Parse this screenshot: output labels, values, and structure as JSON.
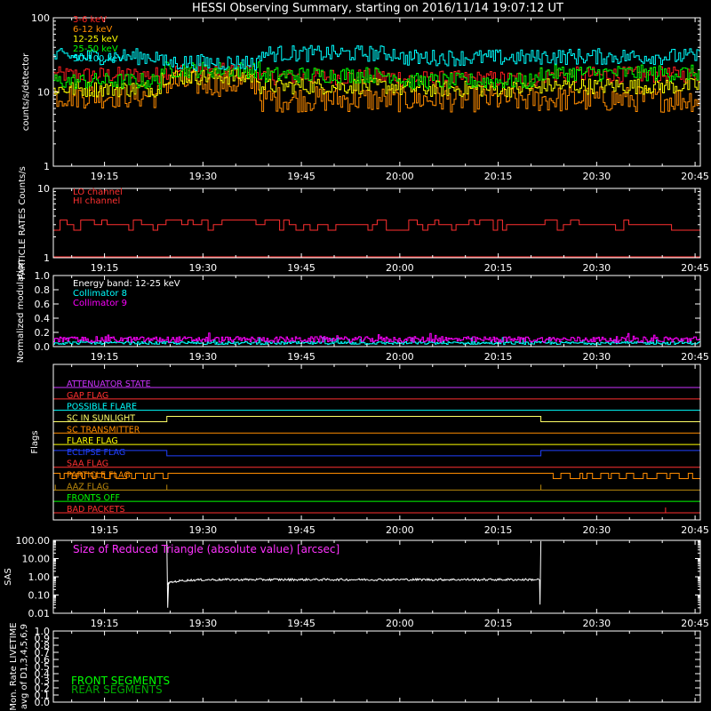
{
  "title": "HESSI Observing Summary, starting on 2016/11/14 19:07:12 UT",
  "time_ticks": [
    "19:15",
    "19:30",
    "19:45",
    "20:00",
    "20:15",
    "20:30",
    "20:45"
  ],
  "time_tick_minutes": [
    15,
    30,
    45,
    60,
    75,
    90,
    105
  ],
  "time_range_minutes": [
    7.2,
    105.8
  ],
  "chart_data": [
    {
      "type": "line",
      "panel": "count-rates",
      "ylabel": "counts/s/detector",
      "yscale": "log",
      "ylim": [
        1,
        100
      ],
      "yticks": [
        "1",
        "10",
        "100"
      ],
      "series": [
        {
          "name": "3-6 keV",
          "color": "#ff2020",
          "segments": [
            [
              7.2,
              23.5,
              17
            ],
            [
              23.5,
              38.5,
              19
            ],
            [
              38.5,
              60,
              16
            ],
            [
              60,
              81,
              15
            ],
            [
              81,
              105.8,
              17
            ]
          ]
        },
        {
          "name": "6-12 keV",
          "color": "#ff8c00",
          "segments": [
            [
              7.2,
              23.5,
              9
            ],
            [
              23.5,
              38.5,
              13
            ],
            [
              38.5,
              60,
              8
            ],
            [
              60,
              81,
              8
            ],
            [
              81,
              105.8,
              8
            ]
          ]
        },
        {
          "name": "12-25 keV",
          "color": "#ffff00",
          "segments": [
            [
              7.2,
              23.5,
              11
            ],
            [
              23.5,
              38.5,
              16
            ],
            [
              38.5,
              60,
              12
            ],
            [
              60,
              81,
              11
            ],
            [
              81,
              105.8,
              12
            ]
          ]
        },
        {
          "name": "25-50 keV",
          "color": "#00ff00",
          "segments": [
            [
              7.2,
              23.5,
              14
            ],
            [
              23.5,
              38.5,
              20
            ],
            [
              38.5,
              60,
              17
            ],
            [
              60,
              81,
              14
            ],
            [
              81,
              105.8,
              18
            ]
          ]
        },
        {
          "name": "50-100 keV",
          "color": "#00ffff",
          "segments": [
            [
              7.2,
              23.5,
              30
            ],
            [
              23.5,
              38.5,
              25
            ],
            [
              38.5,
              60,
              33
            ],
            [
              60,
              81,
              29
            ],
            [
              81,
              105.8,
              30
            ]
          ]
        }
      ]
    },
    {
      "type": "line",
      "panel": "particle-rates",
      "ylabel": "PARTICLE RATES Counts/s",
      "yscale": "log",
      "ylim": [
        1,
        10
      ],
      "yticks": [
        "1",
        "10"
      ],
      "series": [
        {
          "name": "LO channel",
          "color": "#ff3030",
          "baseline": 3,
          "low": 2.5,
          "high": 3.5
        },
        {
          "name": "HI channel",
          "color": "#ff3030",
          "baseline": 1,
          "low": 1,
          "high": 1
        }
      ]
    },
    {
      "type": "line",
      "panel": "modulation",
      "ylabel": "Normalized modulation",
      "ylim": [
        0,
        1
      ],
      "yticks": [
        "0.0",
        "0.2",
        "0.4",
        "0.6",
        "0.8",
        "1.0"
      ],
      "annotation": "Energy band: 12-25 keV",
      "series": [
        {
          "name": "Collimator 8",
          "color": "#00ffff",
          "level": 0.05
        },
        {
          "name": "Collimator 9",
          "color": "#ff00ff",
          "level": 0.1
        }
      ]
    },
    {
      "type": "line",
      "panel": "flags",
      "ylabel": "Flags",
      "series": [
        {
          "name": "ATTENUATOR STATE",
          "color": "#cc33ff",
          "state": "flat"
        },
        {
          "name": "GAP FLAG",
          "color": "#ff3030",
          "state": "flat"
        },
        {
          "name": "POSSIBLE FLARE",
          "color": "#00ffff",
          "state": "flat"
        },
        {
          "name": "SC IN SUNLIGHT",
          "color": "#ffff66",
          "state": "high",
          "high_range": [
            24.5,
            81.5
          ]
        },
        {
          "name": "SC TRANSMITTER",
          "color": "#ff8c00",
          "state": "flat"
        },
        {
          "name": "FLARE FLAG",
          "color": "#ffff00",
          "state": "flat"
        },
        {
          "name": "ECLIPSE FLAG",
          "color": "#2040ff",
          "state": "high",
          "high_ranges": [
            [
              7.2,
              24.5
            ],
            [
              81.5,
              105.8
            ]
          ]
        },
        {
          "name": "SAA FLAG",
          "color": "#ff3030",
          "state": "flat"
        },
        {
          "name": "PARTICLE FLAG",
          "color": "#ff8c00",
          "state": "toggle"
        },
        {
          "name": "AAZ FLAG",
          "color": "#b8860b",
          "state": "spikes",
          "spikes": [
            7.5,
            24.5,
            81.5
          ]
        },
        {
          "name": "FRONTS OFF",
          "color": "#00ff00",
          "state": "flat"
        },
        {
          "name": "BAD PACKETS",
          "color": "#ff3030",
          "state": "spikes",
          "spikes": [
            100.5
          ]
        }
      ]
    },
    {
      "type": "line",
      "panel": "sas",
      "ylabel": "SAS",
      "yscale": "log",
      "ylim": [
        0.01,
        100
      ],
      "yticks": [
        "0.01",
        "0.10",
        "1.00",
        "10.00",
        "100.00"
      ],
      "annotation": "Size of Reduced Triangle (absolute value) [arcsec]",
      "series": [
        {
          "name": "",
          "color": "#ffffff",
          "active_range": [
            24.5,
            81.5
          ],
          "level": 0.7
        }
      ]
    },
    {
      "type": "line",
      "panel": "livetime",
      "ylabel": "Mon. Rate LIVETIME avg of D1,3,4,5,6,9",
      "ylim": [
        0,
        1
      ],
      "yticks": [
        "0.0",
        "0.1",
        "0.2",
        "0.3",
        "0.4",
        "0.5",
        "0.6",
        "0.7",
        "0.8",
        "0.9",
        "1.0"
      ],
      "series": [
        {
          "name": "FRONT SEGMENTS",
          "color": "#00ff00"
        },
        {
          "name": "REAR SEGMENTS",
          "color": "#00aa00"
        }
      ]
    }
  ]
}
